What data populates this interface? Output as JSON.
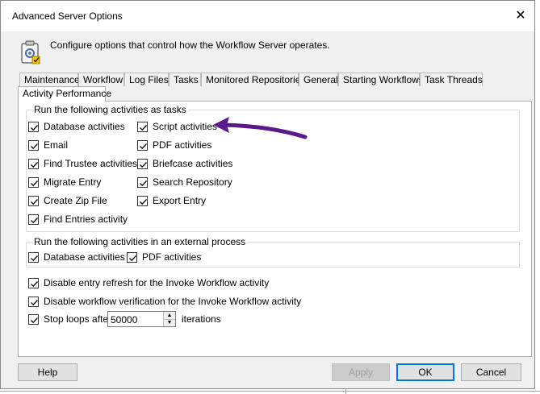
{
  "window": {
    "title": "Advanced Server Options"
  },
  "header": {
    "description": "Configure options that control how the Workflow Server operates.",
    "icon": "clipboard-settings-icon"
  },
  "tabs": [
    {
      "label": "Maintenance"
    },
    {
      "label": "Workflow"
    },
    {
      "label": "Log Files"
    },
    {
      "label": "Tasks"
    },
    {
      "label": "Monitored Repositories"
    },
    {
      "label": "General"
    },
    {
      "label": "Starting Workflows"
    },
    {
      "label": "Task Threads"
    },
    {
      "label": "Activity Performance",
      "selected": true
    }
  ],
  "group_tasks": {
    "legend": "Run the following activities as tasks",
    "items": [
      {
        "label": "Database activities",
        "checked": true
      },
      {
        "label": "Email",
        "checked": true
      },
      {
        "label": "Find Trustee activities",
        "checked": true
      },
      {
        "label": "Migrate Entry",
        "checked": true
      },
      {
        "label": "Create Zip File",
        "checked": true
      },
      {
        "label": "Find Entries activity",
        "checked": true
      },
      {
        "label": "Script activities",
        "checked": true
      },
      {
        "label": "PDF activities",
        "checked": true
      },
      {
        "label": "Briefcase activities",
        "checked": true
      },
      {
        "label": "Search Repository",
        "checked": true
      },
      {
        "label": "Export Entry",
        "checked": true
      }
    ]
  },
  "group_external": {
    "legend": "Run the following activities in an external process",
    "items": [
      {
        "label": "Database activities",
        "checked": true
      },
      {
        "label": "PDF activities",
        "checked": true
      }
    ]
  },
  "options": {
    "disable_refresh": {
      "label": "Disable entry refresh for the Invoke Workflow activity",
      "checked": true
    },
    "disable_verification": {
      "label": "Disable workflow verification for the Invoke Workflow activity",
      "checked": true
    },
    "stop_loops": {
      "label": "Stop loops after",
      "checked": true,
      "value": "50000",
      "suffix": "iterations"
    }
  },
  "buttons": {
    "help": "Help",
    "apply": "Apply",
    "ok": "OK",
    "cancel": "Cancel"
  },
  "annotation": {
    "color": "#5a1a8c"
  }
}
